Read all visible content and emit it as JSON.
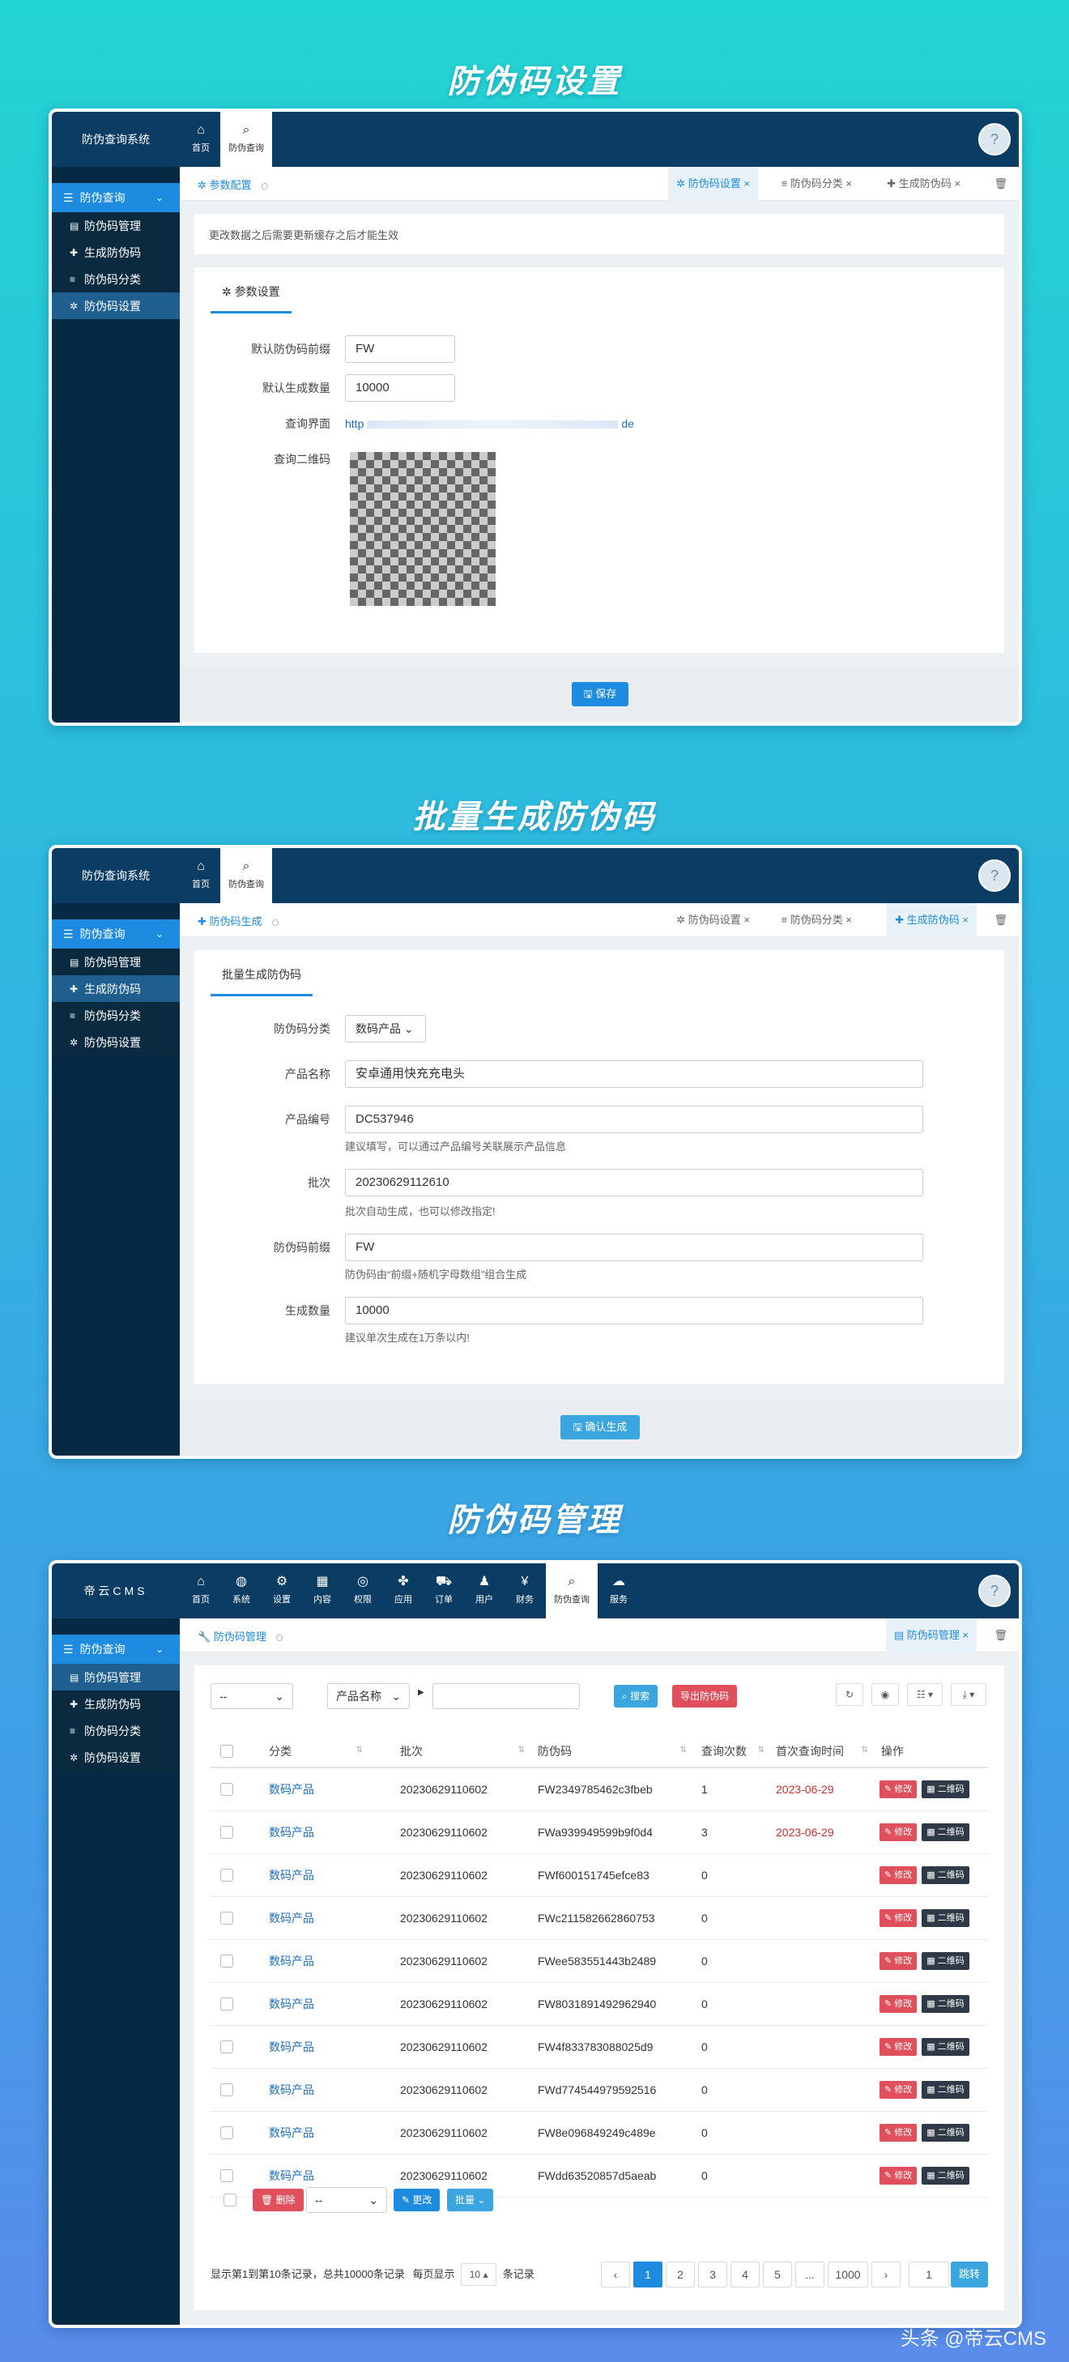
{
  "sections": {
    "s1_title": "防伪码设置",
    "s2_title": "批量生成防伪码",
    "s3_title": "防伪码管理"
  },
  "app1": {
    "brand": "防伪查询系统",
    "nav": [
      {
        "label": "首页",
        "icon": "home-icon"
      },
      {
        "label": "防伪查询",
        "icon": "search-icon"
      }
    ],
    "sidebar_head": "防伪查询",
    "sidebar_items": [
      "防伪码管理",
      "生成防伪码",
      "防伪码分类",
      "防伪码设置"
    ],
    "tab_left": "参数配置",
    "tabs_right": [
      "防伪码设置",
      "防伪码分类",
      "生成防伪码"
    ],
    "notice": "更改数据之后需要更新缓存之后才能生效",
    "form_tab": "参数设置",
    "fields": [
      {
        "label": "默认防伪码前缀",
        "value": "FW"
      },
      {
        "label": "默认生成数量",
        "value": "10000"
      }
    ],
    "query_page_label": "查询界面",
    "query_page_value": "http",
    "query_page_tail": "de",
    "qr_label": "查询二维码",
    "save_button": "保存"
  },
  "app2": {
    "brand": "防伪查询系统",
    "nav": [
      {
        "label": "首页",
        "icon": "home-icon"
      },
      {
        "label": "防伪查询",
        "icon": "search-icon"
      }
    ],
    "sidebar_head": "防伪查询",
    "sidebar_items": [
      "防伪码管理",
      "生成防伪码",
      "防伪码分类",
      "防伪码设置"
    ],
    "tab_left": "防伪码生成",
    "tabs_right": [
      "防伪码设置",
      "防伪码分类",
      "生成防伪码"
    ],
    "form_tab": "批量生成防伪码",
    "category_label": "防伪码分类",
    "category_value": "数码产品",
    "fields": [
      {
        "label": "产品名称",
        "value": "安卓通用快充充电头",
        "help": ""
      },
      {
        "label": "产品编号",
        "value": "DC537946",
        "help": "建议填写，可以通过产品编号关联展示产品信息"
      },
      {
        "label": "批次",
        "value": "20230629112610",
        "help": "批次自动生成，也可以修改指定!"
      },
      {
        "label": "防伪码前缀",
        "value": "FW",
        "help": "防伪码由“前缀+随机字母数组”组合生成"
      },
      {
        "label": "生成数量",
        "value": "10000",
        "help": "建议单次生成在1万条以内!"
      }
    ],
    "confirm_button": "确认生成"
  },
  "app3": {
    "brand": "帝云CMS",
    "nav": [
      {
        "label": "首页",
        "icon": "home-icon"
      },
      {
        "label": "系统",
        "icon": "globe-icon"
      },
      {
        "label": "设置",
        "icon": "gears-icon"
      },
      {
        "label": "内容",
        "icon": "grid-icon"
      },
      {
        "label": "权限",
        "icon": "user-circle-icon"
      },
      {
        "label": "应用",
        "icon": "puzzle-icon"
      },
      {
        "label": "订单",
        "icon": "cart-icon"
      },
      {
        "label": "用户",
        "icon": "user-icon"
      },
      {
        "label": "财务",
        "icon": "yen-icon"
      },
      {
        "label": "防伪查询",
        "icon": "search-icon"
      },
      {
        "label": "服务",
        "icon": "cloud-icon"
      }
    ],
    "sidebar_head": "防伪查询",
    "sidebar_items": [
      "防伪码管理",
      "生成防伪码",
      "防伪码分类",
      "防伪码设置"
    ],
    "tab_left": "防伪码管理",
    "tab_right": "防伪码管理",
    "filter_select": "--",
    "field_select": "产品名称",
    "search_button": "搜索",
    "export_button": "导出防伪码",
    "columns": [
      "分类",
      "批次",
      "防伪码",
      "查询次数",
      "首次查询时间",
      "操作"
    ],
    "rows": [
      {
        "cat": "数码产品",
        "batch": "20230629110602",
        "code": "FW2349785462c3fbeb",
        "count": "1",
        "first": "2023-06-29"
      },
      {
        "cat": "数码产品",
        "batch": "20230629110602",
        "code": "FWa939949599b9f0d4",
        "count": "3",
        "first": "2023-06-29"
      },
      {
        "cat": "数码产品",
        "batch": "20230629110602",
        "code": "FWf600151745efce83",
        "count": "0",
        "first": ""
      },
      {
        "cat": "数码产品",
        "batch": "20230629110602",
        "code": "FWc211582662860753",
        "count": "0",
        "first": ""
      },
      {
        "cat": "数码产品",
        "batch": "20230629110602",
        "code": "FWee583551443b2489",
        "count": "0",
        "first": ""
      },
      {
        "cat": "数码产品",
        "batch": "20230629110602",
        "code": "FW8031891492962940",
        "count": "0",
        "first": ""
      },
      {
        "cat": "数码产品",
        "batch": "20230629110602",
        "code": "FW4f833783088025d9",
        "count": "0",
        "first": ""
      },
      {
        "cat": "数码产品",
        "batch": "20230629110602",
        "code": "FWd774544979592516",
        "count": "0",
        "first": ""
      },
      {
        "cat": "数码产品",
        "batch": "20230629110602",
        "code": "FW8e096849249c489e",
        "count": "0",
        "first": ""
      },
      {
        "cat": "数码产品",
        "batch": "20230629110602",
        "code": "FWdd63520857d5aeab",
        "count": "0",
        "first": ""
      }
    ],
    "row_edit": "修改",
    "row_qr": "二维码",
    "delete_button": "删除",
    "bulk_select": "--",
    "change_button": "更改",
    "batch_button": "批量",
    "pager_info": "显示第1到第10条记录，总共10000条记录",
    "per_page_prefix": "每页显示",
    "per_page_value": "10",
    "per_page_suffix": "条记录",
    "pages": [
      "‹",
      "1",
      "2",
      "3",
      "4",
      "5",
      "...",
      "1000",
      "›"
    ],
    "jump_value": "1",
    "jump_button": "跳转"
  },
  "watermark": "头条 @帝云CMS"
}
